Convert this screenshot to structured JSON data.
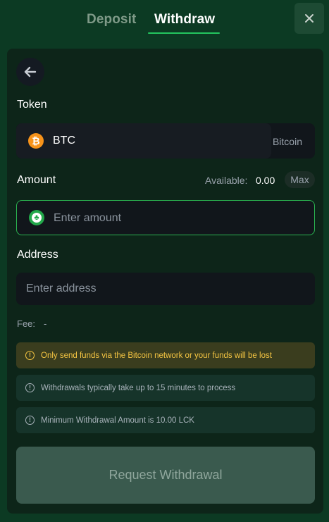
{
  "tabs": {
    "deposit_label": "Deposit",
    "withdraw_label": "Withdraw",
    "active": "withdraw"
  },
  "close_icon": "close-icon",
  "back_icon": "arrow-left-icon",
  "token": {
    "label": "Token",
    "symbol": "BTC",
    "name": "Bitcoin",
    "icon": "bitcoin-icon"
  },
  "amount": {
    "label": "Amount",
    "available_label": "Available:",
    "available_value": "0.00",
    "max_label": "Max",
    "placeholder": "Enter amount",
    "icon": "lucky-chip-icon"
  },
  "address": {
    "label": "Address",
    "placeholder": "Enter address"
  },
  "fee": {
    "label": "Fee:",
    "value": "-"
  },
  "notices": {
    "warning": "Only send funds via the Bitcoin network or your funds will be lost",
    "info_1": "Withdrawals typically take up to 15 minutes to process",
    "info_2": "Minimum Withdrawal Amount is 10.00 LCK"
  },
  "submit_label": "Request Withdrawal",
  "colors": {
    "background": "#0c3a23",
    "panel": "#0d2519",
    "accent": "#23c55e",
    "warning": "#f5c542",
    "bitcoin": "#f7931a"
  }
}
